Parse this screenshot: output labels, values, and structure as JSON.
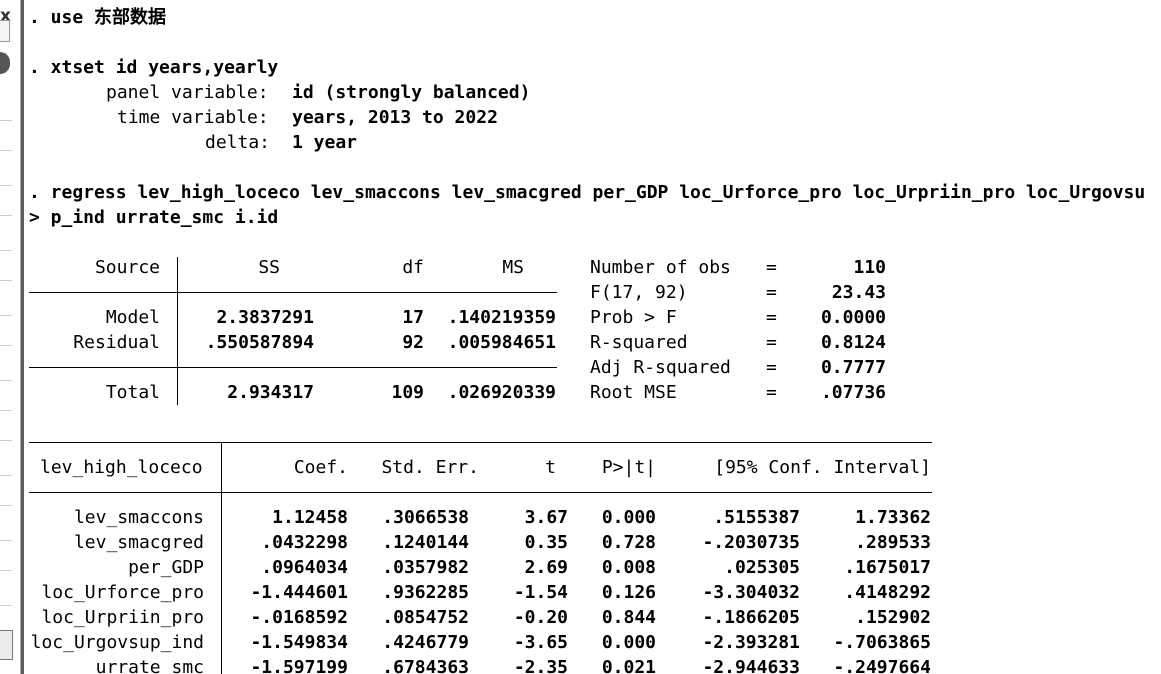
{
  "log": {
    "line1_prefix": ". use ",
    "line1_file": "东部数据",
    "line2": ". xtset id years,yearly",
    "panel_label": "panel variable:",
    "panel_value": "id (strongly balanced)",
    "time_label": "time variable:",
    "time_value": "years, 2013 to 2022",
    "delta_label": "delta:",
    "delta_value": "1 year",
    "regress_line": ". regress lev_high_loceco lev_smaccons lev_smacgred per_GDP loc_Urforce_pro loc_Urpriin_pro loc_Urgovsu",
    "regress_cont": "> p_ind urrate_smc i.id"
  },
  "anova": {
    "headers": [
      "Source",
      "SS",
      "df",
      "MS"
    ],
    "rows": [
      {
        "source": "Model",
        "ss": "2.3837291",
        "df": "17",
        "ms": ".140219359"
      },
      {
        "source": "Residual",
        "ss": ".550587894",
        "df": "92",
        "ms": ".005984651"
      },
      {
        "source": "Total",
        "ss": "2.934317",
        "df": "109",
        "ms": ".026920339"
      }
    ]
  },
  "stats": [
    {
      "label": "Number of obs",
      "eq": "=",
      "value": "110"
    },
    {
      "label": "F(17, 92)",
      "eq": "=",
      "value": "23.43"
    },
    {
      "label": "Prob > F",
      "eq": "=",
      "value": "0.0000"
    },
    {
      "label": "R-squared",
      "eq": "=",
      "value": "0.8124"
    },
    {
      "label": "Adj R-squared",
      "eq": "=",
      "value": "0.7777"
    },
    {
      "label": "Root MSE",
      "eq": "=",
      "value": ".07736"
    }
  ],
  "coef": {
    "depvar": "lev_high_loceco",
    "headers": [
      "Coef.",
      "Std. Err.",
      "t",
      "P>|t|",
      "[95% Conf. Interval]"
    ],
    "rows": [
      {
        "var": "lev_smaccons",
        "coef": "1.12458",
        "se": ".3066538",
        "t": "3.67",
        "p": "0.000",
        "lo": ".5155387",
        "hi": "1.73362"
      },
      {
        "var": "lev_smacgred",
        "coef": ".0432298",
        "se": ".1240144",
        "t": "0.35",
        "p": "0.728",
        "lo": "-.2030735",
        "hi": ".289533"
      },
      {
        "var": "per_GDP",
        "coef": ".0964034",
        "se": ".0357982",
        "t": "2.69",
        "p": "0.008",
        "lo": ".025305",
        "hi": ".1675017"
      },
      {
        "var": "loc_Urforce_pro",
        "coef": "-1.444601",
        "se": ".9362285",
        "t": "-1.54",
        "p": "0.126",
        "lo": "-3.304032",
        "hi": ".4148292"
      },
      {
        "var": "loc_Urpriin_pro",
        "coef": "-.0168592",
        "se": ".0854752",
        "t": "-0.20",
        "p": "0.844",
        "lo": "-.1866205",
        "hi": ".152902"
      },
      {
        "var": "loc_Urgovsup_ind",
        "coef": "-1.549834",
        "se": ".4246779",
        "t": "-3.65",
        "p": "0.000",
        "lo": "-2.393281",
        "hi": "-.7063865"
      },
      {
        "var": "urrate_smc",
        "coef": "-1.597199",
        "se": ".6784363",
        "t": "-2.35",
        "p": "0.021",
        "lo": "-2.944633",
        "hi": "-.2497664"
      }
    ]
  },
  "sidebar": {
    "close_glyph": "x"
  }
}
